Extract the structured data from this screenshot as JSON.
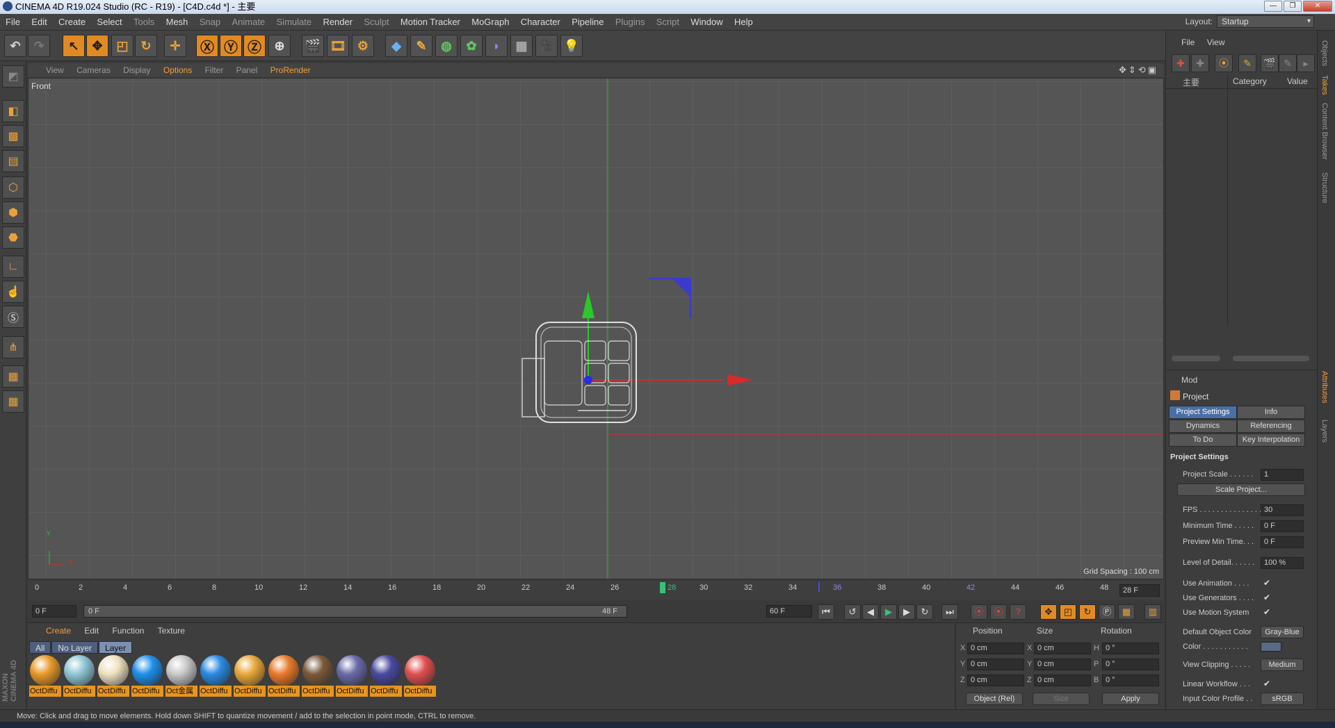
{
  "window": {
    "title": "CINEMA 4D R19.024 Studio (RC - R19) - [C4D.c4d *] - 主要",
    "buttons": [
      "—",
      "❐",
      "✕"
    ]
  },
  "menu": [
    "File",
    "Edit",
    "Create",
    "Select",
    "Tools",
    "Mesh",
    "Snap",
    "Animate",
    "Simulate",
    "Render",
    "Sculpt",
    "Motion Tracker",
    "MoGraph",
    "Character",
    "Pipeline",
    "Plugins",
    "Script",
    "Window",
    "Help"
  ],
  "layout": {
    "label": "Layout:",
    "value": "Startup"
  },
  "viewport": {
    "menu": [
      "View",
      "Cameras",
      "Display",
      "Options",
      "Filter",
      "Panel",
      "ProRender"
    ],
    "active_menu": "Options",
    "name": "Front",
    "grid_spacing": "Grid Spacing : 100 cm",
    "axis_y": "Y",
    "axis_x": "X"
  },
  "timeline": {
    "ticks": [
      "0",
      "2",
      "4",
      "6",
      "8",
      "10",
      "12",
      "14",
      "16",
      "18",
      "20",
      "22",
      "24",
      "26",
      "28",
      "30",
      "32",
      "34",
      "36",
      "38",
      "40",
      "42",
      "44",
      "46",
      "48"
    ],
    "current_frame": "28 F",
    "start": "0 F",
    "range_start": "0 F",
    "range_end": "48 F",
    "end": "60 F"
  },
  "materials": {
    "menu": [
      "Create",
      "Edit",
      "Function",
      "Texture"
    ],
    "tabs": [
      "All",
      "No Layer",
      "Layer"
    ],
    "items": [
      {
        "label": "OctDiffu",
        "color": "#e89a2a"
      },
      {
        "label": "OctDiffu",
        "color": "#8fc6d6"
      },
      {
        "label": "OctDiffu",
        "color": "#efe0c0"
      },
      {
        "label": "OctDiffu",
        "color": "#1e8fe8"
      },
      {
        "label": "Oct金属",
        "color": "#c8c8c8"
      },
      {
        "label": "OctDiffu",
        "color": "#2a8ae0"
      },
      {
        "label": "OctDiffu",
        "color": "#e8a83a"
      },
      {
        "label": "OctDiffu",
        "color": "#e87a2a"
      },
      {
        "label": "OctDiffu",
        "color": "#7a5a3a"
      },
      {
        "label": "OctDiffu",
        "color": "#6a6aaa"
      },
      {
        "label": "OctDiffu",
        "color": "#4a4aa0"
      },
      {
        "label": "OctDiffu",
        "color": "#e05050"
      }
    ],
    "brand": "MAXON CINEMA 4D"
  },
  "coords": {
    "headers": [
      "Position",
      "Size",
      "Rotation"
    ],
    "rows": [
      {
        "axis": "X",
        "pos": "0 cm",
        "size_axis": "X",
        "size": "0 cm",
        "rot_axis": "H",
        "rot": "0 °"
      },
      {
        "axis": "Y",
        "pos": "0 cm",
        "size_axis": "Y",
        "size": "0 cm",
        "rot_axis": "P",
        "rot": "0 °"
      },
      {
        "axis": "Z",
        "pos": "0 cm",
        "size_axis": "Z",
        "size": "0 cm",
        "rot_axis": "B",
        "rot": "0 °"
      }
    ],
    "mode": "Object (Rel)",
    "size_mode": "Size",
    "apply": "Apply"
  },
  "status": "Move: Click and drag to move elements. Hold down SHIFT to quantize movement / add to the selection in point mode, CTRL to remove.",
  "objects": {
    "menu": [
      "File",
      "View"
    ],
    "tree_item": "主要",
    "columns": [
      "Category",
      "Value"
    ]
  },
  "attributes": {
    "mode": "Mod",
    "title": "Project",
    "tabs": [
      "Project Settings",
      "Info",
      "Dynamics",
      "Referencing",
      "To Do",
      "Key Interpolation"
    ],
    "section": "Project Settings",
    "rows": [
      {
        "label": "Project Scale . . . . . .",
        "value": "1"
      },
      {
        "label": "FPS . . . . . . . . . . . . . . .",
        "value": "30"
      },
      {
        "label": "Minimum Time . . . . .",
        "value": "0 F"
      },
      {
        "label": "Preview Min Time. . .",
        "value": "0 F"
      },
      {
        "label": "Level of Detail. . . . . .",
        "value": "100 %"
      }
    ],
    "scale_button": "Scale Project...",
    "checks": [
      "Use Animation . . . .",
      "Use Generators . . . .",
      "Use Motion System"
    ],
    "default_color_label": "Default Object Color",
    "default_color_value": "Gray-Blue",
    "color_label": "Color . . . . . . . . . . .",
    "view_clipping_label": "View Clipping . . . . .",
    "view_clipping_value": "Medium",
    "linear_workflow": "Linear Workflow . . .",
    "input_profile_label": "Input Color Profile . .",
    "input_profile_value": "sRGB"
  },
  "side_tabs": [
    "Objects",
    "Takes",
    "Content Browser",
    "Structure",
    "Attributes",
    "Layers"
  ]
}
